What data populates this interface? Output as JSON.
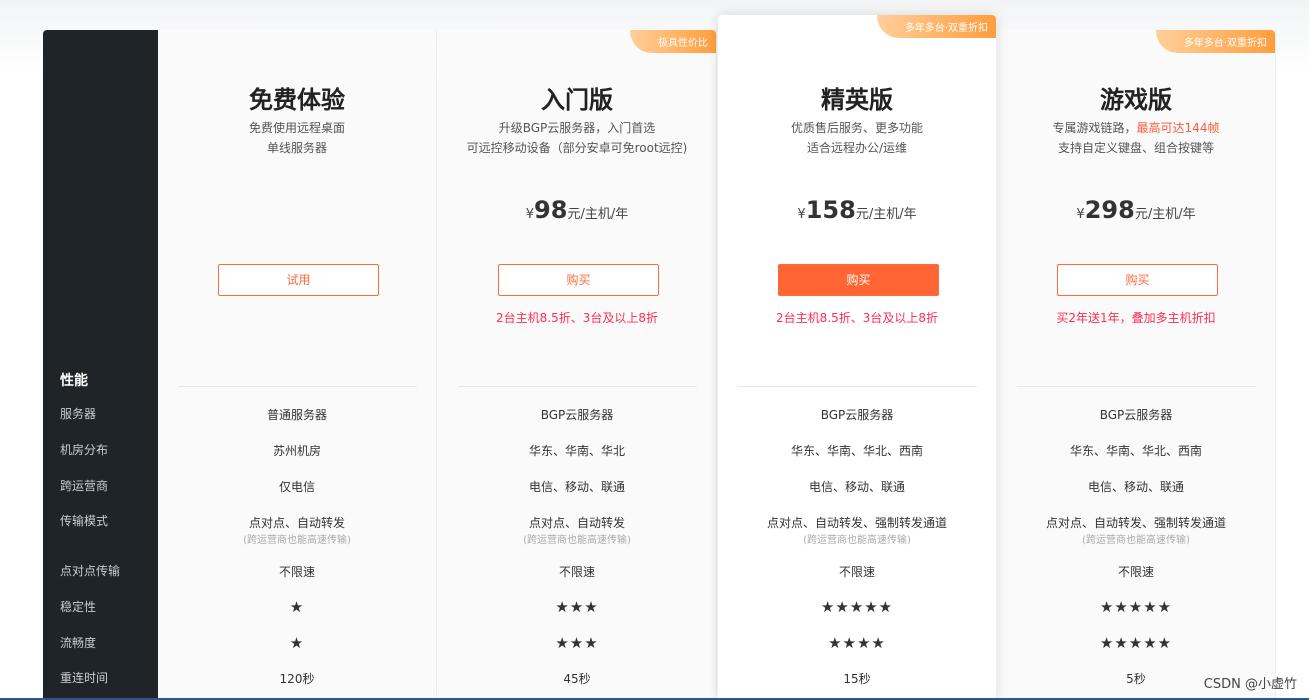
{
  "sidebar": {
    "heading": "性能",
    "rows": [
      "服务器",
      "机房分布",
      "跨运营商",
      "传输模式",
      "点对点传输",
      "稳定性",
      "流畅度",
      "重连时间"
    ]
  },
  "plans": [
    {
      "tag": null,
      "title": "免费体验",
      "desc1": "免费使用远程桌面",
      "desc2": "单线服务器",
      "price": null,
      "button": "试用",
      "promo": "",
      "server": "普通服务器",
      "region": "苏州机房",
      "isp": "仅电信",
      "mode": "点对点、自动转发",
      "mode_sub": "(跨运营商也能高速传输)",
      "p2p": "不限速",
      "stability": "★",
      "smooth": "★",
      "reconnect": "120秒"
    },
    {
      "tag": "极具性价比",
      "title": "入门版",
      "desc1": "升级BGP云服务器，入门首选",
      "desc2": "可远控移动设备（部分安卓可免root远控)",
      "currency": "¥",
      "price": "98",
      "unit": "元/主机/年",
      "button": "购买",
      "promo": "2台主机8.5折、3台及以上8折",
      "server": "BGP云服务器",
      "region": "华东、华南、华北",
      "isp": "电信、移动、联通",
      "mode": "点对点、自动转发",
      "mode_sub": "(跨运营商也能高速传输)",
      "p2p": "不限速",
      "stability": "★★★",
      "smooth": "★★★",
      "reconnect": "45秒"
    },
    {
      "tag": "多年多台·双重折扣",
      "title": "精英版",
      "desc1": "优质售后服务、更多功能",
      "desc2": "适合远程办公/运维",
      "currency": "¥",
      "price": "158",
      "unit": "元/主机/年",
      "button": "购买",
      "promo": "2台主机8.5折、3台及以上8折",
      "server": "BGP云服务器",
      "region": "华东、华南、华北、西南",
      "isp": "电信、移动、联通",
      "mode": "点对点、自动转发、强制转发通道",
      "mode_sub": "(跨运营商也能高速传输)",
      "p2p": "不限速",
      "stability": "★★★★★",
      "smooth": "★★★★",
      "reconnect": "15秒"
    },
    {
      "tag": "多年多台·双重折扣",
      "title": "游戏版",
      "desc1": "专属游戏链路，",
      "desc1_red": "最高可达144帧",
      "desc2": "支持自定义键盘、组合按键等",
      "currency": "¥",
      "price": "298",
      "unit": "元/主机/年",
      "button": "购买",
      "promo": "买2年送1年，叠加多主机折扣",
      "server": "BGP云服务器",
      "region": "华东、华南、华北、西南",
      "isp": "电信、移动、联通",
      "mode": "点对点、自动转发、强制转发通道",
      "mode_sub": "(跨运营商也能高速传输)",
      "p2p": "不限速",
      "stability": "★★★★★",
      "smooth": "★★★★★",
      "reconnect": "5秒"
    }
  ],
  "watermark": "CSDN @小虚竹"
}
